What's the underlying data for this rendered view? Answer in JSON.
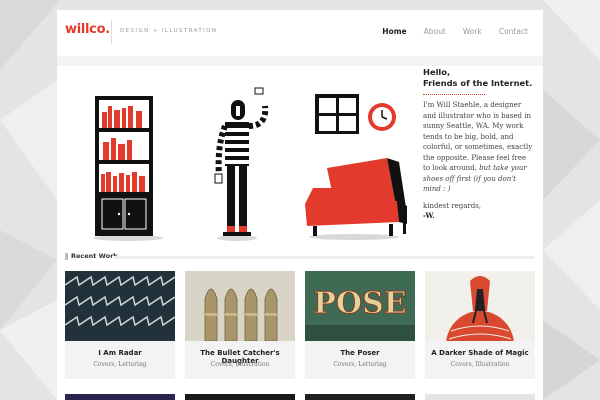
{
  "site": {
    "logo": "willco.",
    "tagline": "DESIGN + ILLUSTRATION",
    "accent_color": "#e23b2e"
  },
  "nav": {
    "items": [
      {
        "label": "Home",
        "active": true
      },
      {
        "label": "About",
        "active": false
      },
      {
        "label": "Work",
        "active": false
      },
      {
        "label": "Contact",
        "active": false
      }
    ]
  },
  "intro": {
    "heading_line1": "Hello,",
    "heading_line2": "Friends of the Internet.",
    "body": "I'm Will Staehle, a designer and illustrator who is based in sunny Seattle, WA. My work tends to be big, bold, and colorful, or sometimes, exactly the opposite. Please feel free to look around,",
    "body_italic": "but take your shoes off first (if you don't mind : )",
    "closing": "kindest regards,",
    "signature": "-W."
  },
  "hero_icons": [
    "bookshelf-illustration",
    "striped-figure-illustration",
    "window-illustration",
    "clock-illustration",
    "armchair-illustration"
  ],
  "recent_work": {
    "label": "Recent Work",
    "cards": [
      {
        "title": "I Am Radar",
        "categories": "Covers, Lettering"
      },
      {
        "title": "The Bullet Catcher's Daughter",
        "categories": "Covers, Illustration"
      },
      {
        "title": "The Poser",
        "categories": "Covers, Lettering"
      },
      {
        "title": "A Darker Shade of Magic",
        "categories": "Covers, Illustration"
      }
    ],
    "thumb_text": {
      "poser": "POSE"
    }
  }
}
